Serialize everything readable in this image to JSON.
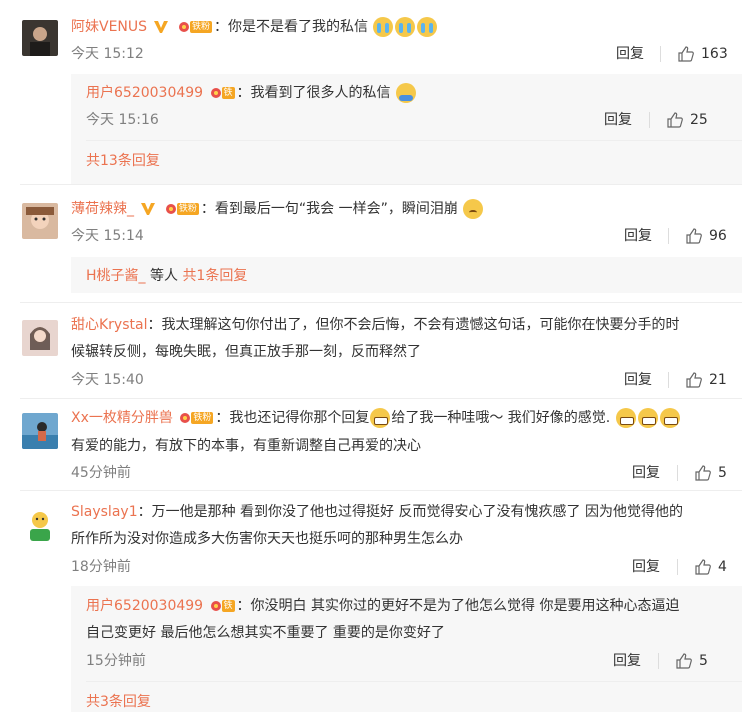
{
  "colors": {
    "accent": "#eb7350",
    "text": "#333333",
    "meta": "#808080",
    "subbg": "#f7f7f7"
  },
  "icons": {
    "like": "thumbs-up-icon",
    "verified": "orange-v-icon",
    "fan": "iron-fan-badge-icon"
  },
  "comments": [
    {
      "user": "阿妹VENUS",
      "fan_label": "铁粉",
      "text": "：你是不是看了我的私信",
      "time": "今天 15:12",
      "reply_label": "回复",
      "likes": "163",
      "sub": {
        "user": "用户6520030499",
        "fan_label": "铁",
        "text": "：我看到了很多人的私信",
        "time": "今天 15:16",
        "reply_label": "回复",
        "likes": "25"
      },
      "more": "共13条回复"
    },
    {
      "user": "薄荷辣辣_",
      "fan_label": "铁粉",
      "text": "：看到最后一句“我会 一样会”，瞬间泪崩",
      "time": "今天 15:14",
      "reply_label": "回复",
      "likes": "96",
      "reply_preview": {
        "user": "H桃子酱_",
        "mid": " 等人 ",
        "more": "共1条回复"
      }
    },
    {
      "user": "甜心Krystal",
      "text_1": "：我太理解这句你付出了，但你不会后悔，不会有遗憾这句话，可能你在快要分手的时",
      "text_2": "候辗转反侧，每晚失眠，但真正放手那一刻，反而释然了",
      "time": "今天 15:40",
      "reply_label": "回复",
      "likes": "21"
    },
    {
      "user": "Xx一枚精分胖兽",
      "fan_label": "铁粉",
      "text_1a": "：我也还记得你那个回复",
      "text_1b": "给了我一种哇哦～ 我们好像的感觉.",
      "text_2": "有爱的能力，有放下的本事，有重新调整自己再爱的决心",
      "time": "45分钟前",
      "reply_label": "回复",
      "likes": "5"
    },
    {
      "user": "Slayslay1",
      "text_1": "：万一他是那种 看到你没了他也过得挺好 反而觉得安心了没有愧疚感了 因为他觉得他的",
      "text_2": "所作所为没对你造成多大伤害你天天也挺乐呵的那种男生怎么办",
      "time": "18分钟前",
      "reply_label": "回复",
      "likes": "4",
      "sub": {
        "user": "用户6520030499",
        "fan_label": "铁",
        "text_1": "：你没明白 其实你过的更好不是为了他怎么觉得 你是要用这种心态逼迫",
        "text_2": "自己变更好 最后他怎么想其实不重要了 重要的是你变好了",
        "time": "15分钟前",
        "reply_label": "回复",
        "likes": "5"
      },
      "more": "共3条回复"
    }
  ]
}
